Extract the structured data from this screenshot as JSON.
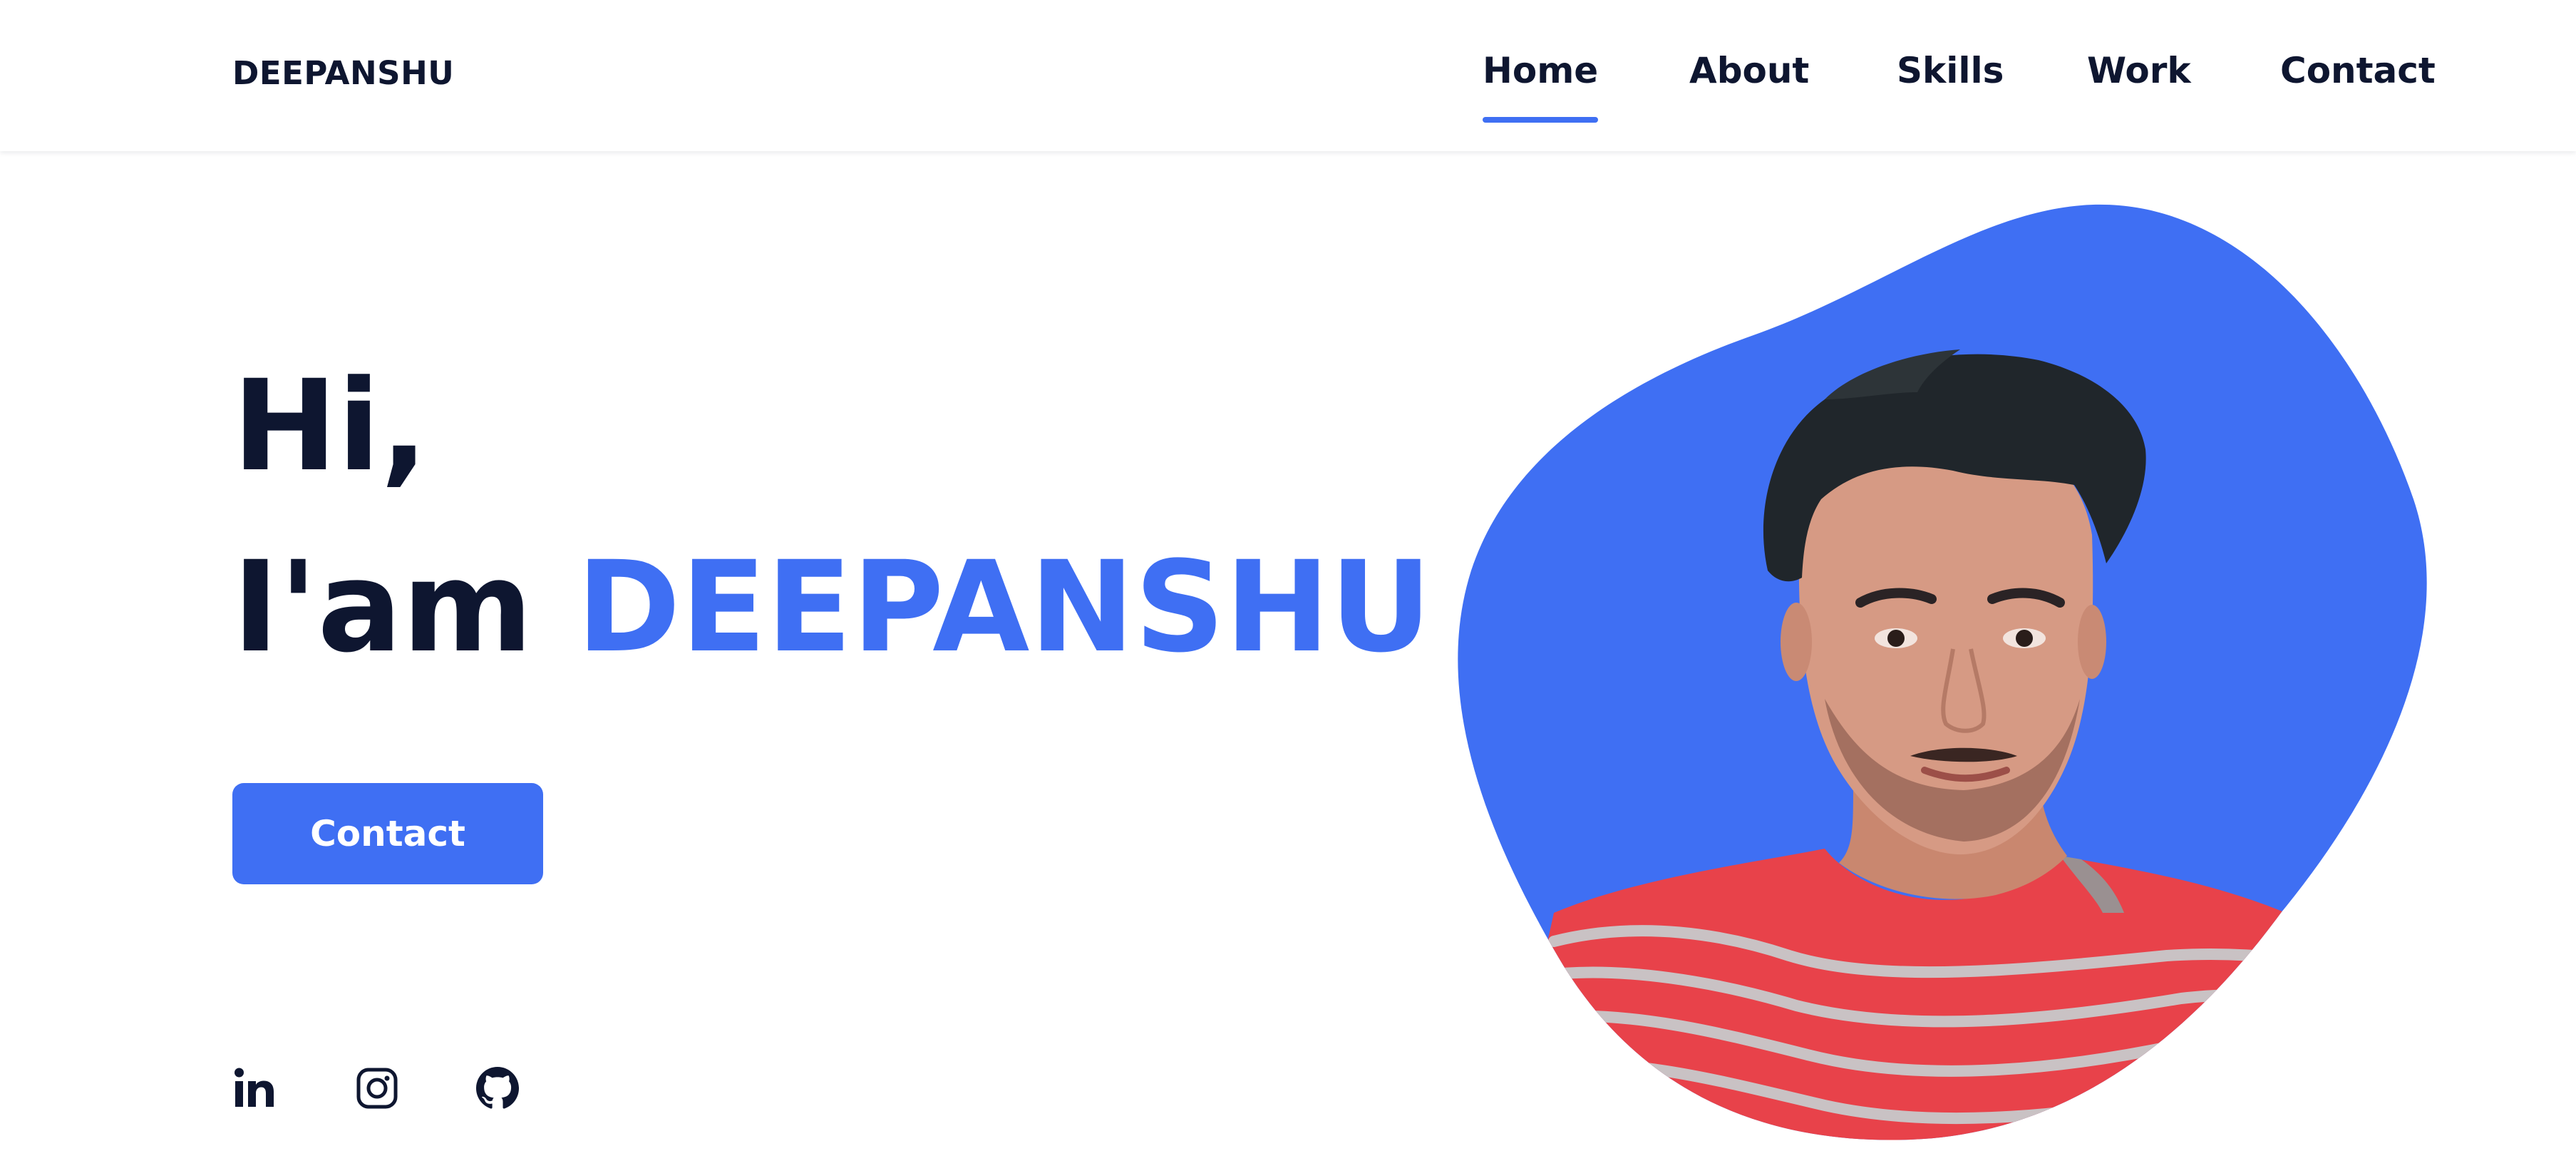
{
  "header": {
    "logo": "DEEPANSHU",
    "nav": [
      {
        "label": "Home",
        "active": true
      },
      {
        "label": "About",
        "active": false
      },
      {
        "label": "Skills",
        "active": false
      },
      {
        "label": "Work",
        "active": false
      },
      {
        "label": "Contact",
        "active": false
      }
    ]
  },
  "hero": {
    "greeting": "Hi,",
    "intro": "I'am",
    "name": "DEEPANSHU",
    "button_label": "Contact"
  },
  "social": [
    {
      "icon": "linkedin-icon"
    },
    {
      "icon": "instagram-icon"
    },
    {
      "icon": "github-icon"
    }
  ],
  "colors": {
    "accent": "#3f6ff3",
    "text": "#0e1630",
    "background": "#ffffff",
    "shirt": "#e8424a",
    "skin": "#d69a84"
  }
}
